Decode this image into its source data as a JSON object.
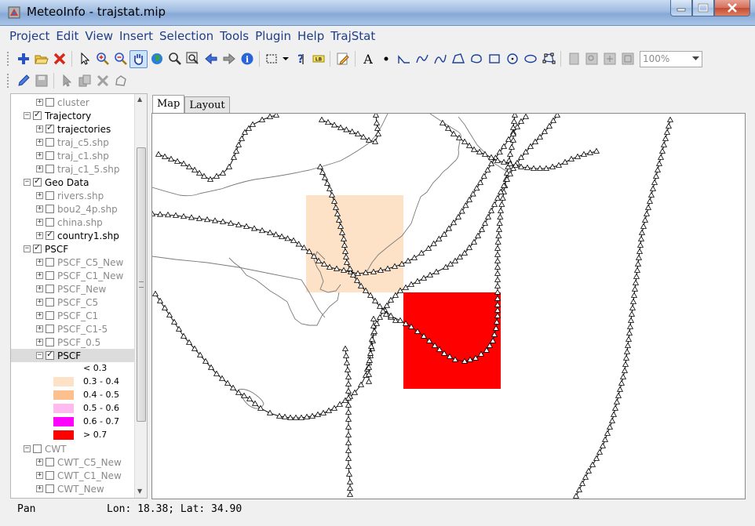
{
  "window": {
    "title": "MeteoInfo - trajstat.mip"
  },
  "menu": [
    "Project",
    "Edit",
    "View",
    "Insert",
    "Selection",
    "Tools",
    "Plugin",
    "Help",
    "TrajStat"
  ],
  "toolbar": {
    "zoom_value": "100%"
  },
  "legend": {
    "items": [
      {
        "label": "cluster",
        "level": 1,
        "expander": "+",
        "checked": false,
        "dim": true
      },
      {
        "label": "Trajectory",
        "level": 0,
        "expander": "−",
        "checked": true,
        "dim": false
      },
      {
        "label": "trajectories",
        "level": 1,
        "expander": "+",
        "checked": true,
        "dim": false
      },
      {
        "label": "traj_c5.shp",
        "level": 1,
        "expander": "+",
        "checked": false,
        "dim": true
      },
      {
        "label": "traj_c1.shp",
        "level": 1,
        "expander": "+",
        "checked": false,
        "dim": true
      },
      {
        "label": "traj_c1_5.shp",
        "level": 1,
        "expander": "+",
        "checked": false,
        "dim": true
      },
      {
        "label": "Geo Data",
        "level": 0,
        "expander": "−",
        "checked": true,
        "dim": false
      },
      {
        "label": "rivers.shp",
        "level": 1,
        "expander": "+",
        "checked": false,
        "dim": true
      },
      {
        "label": "bou2_4p.shp",
        "level": 1,
        "expander": "+",
        "checked": false,
        "dim": true
      },
      {
        "label": "china.shp",
        "level": 1,
        "expander": "+",
        "checked": false,
        "dim": true
      },
      {
        "label": "country1.shp",
        "level": 1,
        "expander": "+",
        "checked": true,
        "dim": false
      },
      {
        "label": "PSCF",
        "level": 0,
        "expander": "−",
        "checked": true,
        "dim": false
      },
      {
        "label": "PSCF_C5_New",
        "level": 1,
        "expander": "+",
        "checked": false,
        "dim": true
      },
      {
        "label": "PSCF_C1_New",
        "level": 1,
        "expander": "+",
        "checked": false,
        "dim": true
      },
      {
        "label": "PSCF_New",
        "level": 1,
        "expander": "+",
        "checked": false,
        "dim": true
      },
      {
        "label": "PSCF_C5",
        "level": 1,
        "expander": "+",
        "checked": false,
        "dim": true
      },
      {
        "label": "PSCF_C1",
        "level": 1,
        "expander": "+",
        "checked": false,
        "dim": true
      },
      {
        "label": "PSCF_C1-5",
        "level": 1,
        "expander": "+",
        "checked": false,
        "dim": true
      },
      {
        "label": "PSCF_0.5",
        "level": 1,
        "expander": "+",
        "checked": false,
        "dim": true
      },
      {
        "label": "PSCF",
        "level": 1,
        "expander": "−",
        "checked": true,
        "dim": false,
        "selected": true
      }
    ],
    "classes": [
      {
        "label": "< 0.3",
        "color": "#ffffff"
      },
      {
        "label": "0.3 - 0.4",
        "color": "#fde2c8"
      },
      {
        "label": "0.4 - 0.5",
        "color": "#fbc08e"
      },
      {
        "label": "0.5 - 0.6",
        "color": "#ffbaf0"
      },
      {
        "label": "0.6 - 0.7",
        "color": "#ff00ff"
      },
      {
        "label": "> 0.7",
        "color": "#ff0000"
      }
    ],
    "after_items": [
      {
        "label": "CWT",
        "level": 0,
        "expander": "−",
        "checked": false,
        "dim": true
      },
      {
        "label": "CWT_C5_New",
        "level": 1,
        "expander": "+",
        "checked": false,
        "dim": true
      },
      {
        "label": "CWT_C1_New",
        "level": 1,
        "expander": "+",
        "checked": false,
        "dim": true
      },
      {
        "label": "CWT_New",
        "level": 1,
        "expander": "+",
        "checked": false,
        "dim": true
      }
    ]
  },
  "tabs": {
    "map": "Map",
    "layout": "Layout"
  },
  "map": {
    "cell_light_color": "#fde2c8",
    "cell_red_color": "#ff0000"
  },
  "status": {
    "mode": "Pan",
    "coords": "Lon: 18.38; Lat: 34.90"
  }
}
